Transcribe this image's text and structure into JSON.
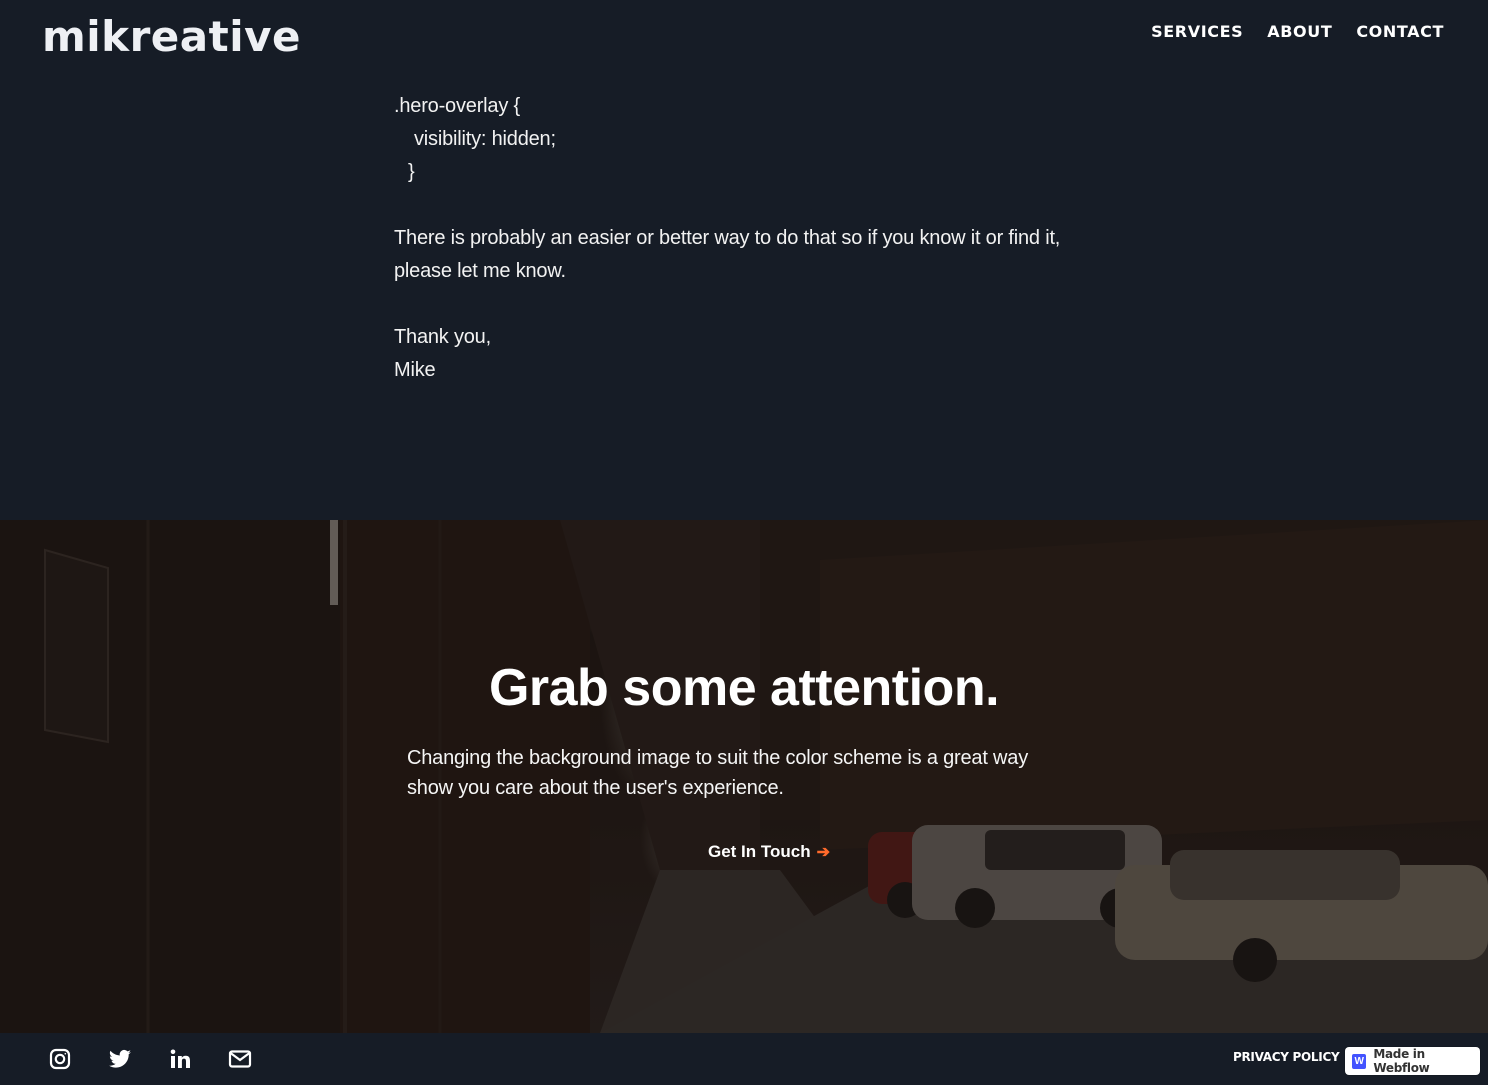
{
  "header": {
    "logo": "mikreative",
    "nav": [
      {
        "label": "SERVICES"
      },
      {
        "label": "ABOUT"
      },
      {
        "label": "CONTACT"
      }
    ]
  },
  "article": {
    "code_lines": [
      ".hero-overlay {",
      "visibility: hidden;",
      "}"
    ],
    "paragraphs": [
      "There is probably an easier or better way to do that so if you know it or find it, please let me know."
    ],
    "signoff": "Thank you,",
    "signature": "Mike"
  },
  "cta": {
    "title": "Grab some attention.",
    "text": "Changing the background image to suit the color scheme is a great way show you care about the user's experience.",
    "link_label": "Get In Touch",
    "link_icon": "arrow-right-icon",
    "accent_color": "#ff6a2b"
  },
  "footer": {
    "social": [
      {
        "name": "instagram",
        "icon": "instagram-icon"
      },
      {
        "name": "twitter",
        "icon": "twitter-icon"
      },
      {
        "name": "linkedin",
        "icon": "linkedin-icon"
      },
      {
        "name": "email",
        "icon": "mail-icon"
      }
    ],
    "privacy_label": "PRIVACY POLICY",
    "webflow_badge": {
      "logo_letter": "W",
      "label": "Made in Webflow",
      "brand_color": "#4353ff"
    }
  },
  "colors": {
    "background": "#161c26",
    "text": "#ffffff"
  }
}
